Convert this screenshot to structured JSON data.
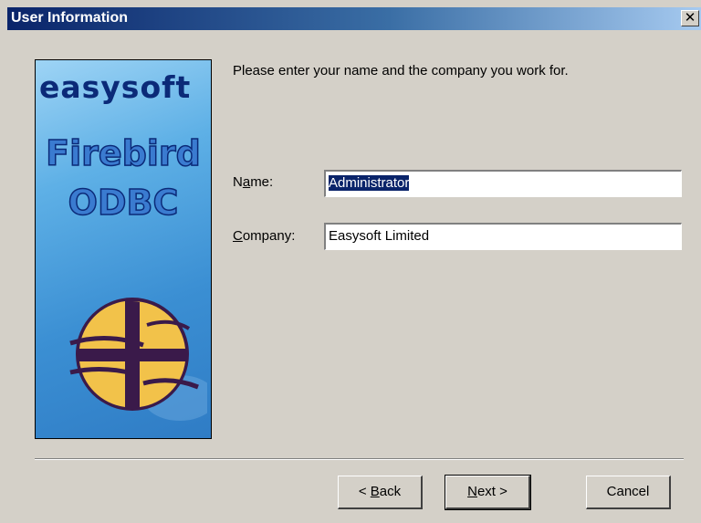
{
  "window": {
    "title": "User Information",
    "close_glyph": "✕"
  },
  "sidebar": {
    "brand": "easysoft",
    "product_line1": "Firebird",
    "product_line2": "ODBC",
    "logo_icon": "easysoft-globe-logo"
  },
  "main": {
    "intro": "Please enter your name and the company you work for.",
    "name_label_pre": "N",
    "name_label_u": "a",
    "name_label_post": "me:",
    "name_value": "Administrator",
    "company_label_u": "C",
    "company_label_post": "ompany:",
    "company_value": "Easysoft Limited"
  },
  "buttons": {
    "back_pre": "< ",
    "back_u": "B",
    "back_post": "ack",
    "next_u": "N",
    "next_post": "ext >",
    "cancel": "Cancel"
  },
  "colors": {
    "title_gradient_start": "#0a246a",
    "selection": "#0a246a",
    "dialog_bg": "#d4d0c8"
  }
}
